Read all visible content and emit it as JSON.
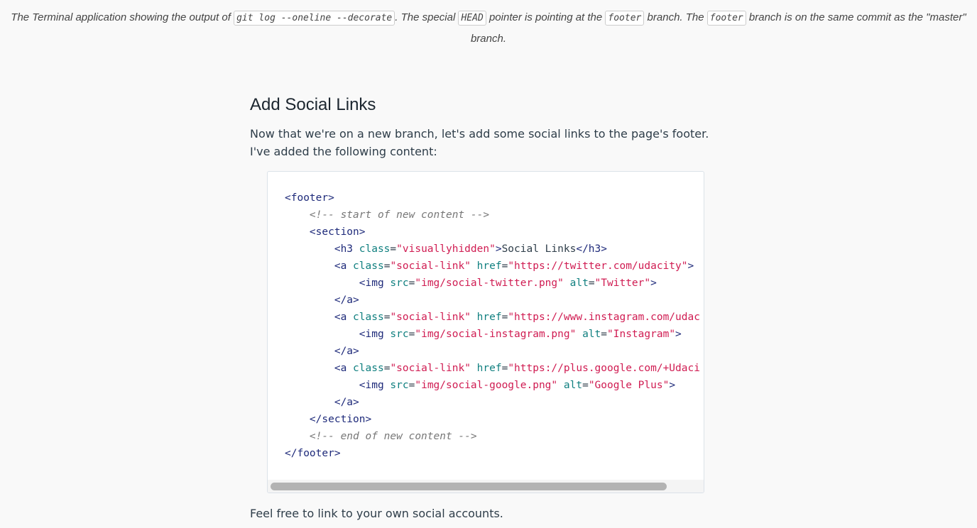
{
  "caption": {
    "part1": "The Terminal application showing the output of ",
    "code1": "git log --oneline --decorate",
    "part2": ". The special ",
    "code2": "HEAD",
    "part3": " pointer is pointing at the ",
    "code3": "footer",
    "part4": " branch. The ",
    "code4": "footer",
    "part5": " branch is on the same commit as the \"master\" branch."
  },
  "section": {
    "heading": "Add Social Links",
    "intro": "Now that we're on a new branch, let's add some social links to the page's footer. I've added the following content:",
    "outro": "Feel free to link to your own social accounts."
  },
  "code_lines": [
    [
      {
        "t": "tag",
        "v": "<footer>"
      }
    ],
    [
      {
        "t": "txt",
        "v": "    "
      },
      {
        "t": "cmt",
        "v": "<!-- start of new content -->"
      }
    ],
    [
      {
        "t": "txt",
        "v": "    "
      },
      {
        "t": "tag",
        "v": "<section>"
      }
    ],
    [
      {
        "t": "txt",
        "v": "        "
      },
      {
        "t": "tag",
        "v": "<h3 "
      },
      {
        "t": "attr",
        "v": "class"
      },
      {
        "t": "txt",
        "v": "="
      },
      {
        "t": "str",
        "v": "\"visuallyhidden\""
      },
      {
        "t": "tag",
        "v": ">"
      },
      {
        "t": "txt",
        "v": "Social Links"
      },
      {
        "t": "tag",
        "v": "</h3>"
      }
    ],
    [
      {
        "t": "txt",
        "v": "        "
      },
      {
        "t": "tag",
        "v": "<a "
      },
      {
        "t": "attr",
        "v": "class"
      },
      {
        "t": "txt",
        "v": "="
      },
      {
        "t": "str",
        "v": "\"social-link\""
      },
      {
        "t": "txt",
        "v": " "
      },
      {
        "t": "attr",
        "v": "href"
      },
      {
        "t": "txt",
        "v": "="
      },
      {
        "t": "str",
        "v": "\"https://twitter.com/udacity\""
      },
      {
        "t": "tag",
        "v": ">"
      }
    ],
    [
      {
        "t": "txt",
        "v": "            "
      },
      {
        "t": "tag",
        "v": "<img "
      },
      {
        "t": "attr",
        "v": "src"
      },
      {
        "t": "txt",
        "v": "="
      },
      {
        "t": "str",
        "v": "\"img/social-twitter.png\""
      },
      {
        "t": "txt",
        "v": " "
      },
      {
        "t": "attr",
        "v": "alt"
      },
      {
        "t": "txt",
        "v": "="
      },
      {
        "t": "str",
        "v": "\"Twitter\""
      },
      {
        "t": "tag",
        "v": ">"
      }
    ],
    [
      {
        "t": "txt",
        "v": "        "
      },
      {
        "t": "tag",
        "v": "</a>"
      }
    ],
    [
      {
        "t": "txt",
        "v": "        "
      },
      {
        "t": "tag",
        "v": "<a "
      },
      {
        "t": "attr",
        "v": "class"
      },
      {
        "t": "txt",
        "v": "="
      },
      {
        "t": "str",
        "v": "\"social-link\""
      },
      {
        "t": "txt",
        "v": " "
      },
      {
        "t": "attr",
        "v": "href"
      },
      {
        "t": "txt",
        "v": "="
      },
      {
        "t": "str",
        "v": "\"https://www.instagram.com/udac"
      }
    ],
    [
      {
        "t": "txt",
        "v": "            "
      },
      {
        "t": "tag",
        "v": "<img "
      },
      {
        "t": "attr",
        "v": "src"
      },
      {
        "t": "txt",
        "v": "="
      },
      {
        "t": "str",
        "v": "\"img/social-instagram.png\""
      },
      {
        "t": "txt",
        "v": " "
      },
      {
        "t": "attr",
        "v": "alt"
      },
      {
        "t": "txt",
        "v": "="
      },
      {
        "t": "str",
        "v": "\"Instagram\""
      },
      {
        "t": "tag",
        "v": ">"
      }
    ],
    [
      {
        "t": "txt",
        "v": "        "
      },
      {
        "t": "tag",
        "v": "</a>"
      }
    ],
    [
      {
        "t": "txt",
        "v": "        "
      },
      {
        "t": "tag",
        "v": "<a "
      },
      {
        "t": "attr",
        "v": "class"
      },
      {
        "t": "txt",
        "v": "="
      },
      {
        "t": "str",
        "v": "\"social-link\""
      },
      {
        "t": "txt",
        "v": " "
      },
      {
        "t": "attr",
        "v": "href"
      },
      {
        "t": "txt",
        "v": "="
      },
      {
        "t": "str",
        "v": "\"https://plus.google.com/+Udaci"
      }
    ],
    [
      {
        "t": "txt",
        "v": "            "
      },
      {
        "t": "tag",
        "v": "<img "
      },
      {
        "t": "attr",
        "v": "src"
      },
      {
        "t": "txt",
        "v": "="
      },
      {
        "t": "str",
        "v": "\"img/social-google.png\""
      },
      {
        "t": "txt",
        "v": " "
      },
      {
        "t": "attr",
        "v": "alt"
      },
      {
        "t": "txt",
        "v": "="
      },
      {
        "t": "str",
        "v": "\"Google Plus\""
      },
      {
        "t": "tag",
        "v": ">"
      }
    ],
    [
      {
        "t": "txt",
        "v": "        "
      },
      {
        "t": "tag",
        "v": "</a>"
      }
    ],
    [
      {
        "t": "txt",
        "v": "    "
      },
      {
        "t": "tag",
        "v": "</section>"
      }
    ],
    [
      {
        "t": "txt",
        "v": "    "
      },
      {
        "t": "cmt",
        "v": "<!-- end of new content -->"
      }
    ],
    [
      {
        "t": "tag",
        "v": "</footer>"
      }
    ]
  ],
  "colors": {
    "tag": "#1e2a7a",
    "attribute": "#0f7f7f",
    "string": "#d01c52",
    "comment": "#777777"
  }
}
